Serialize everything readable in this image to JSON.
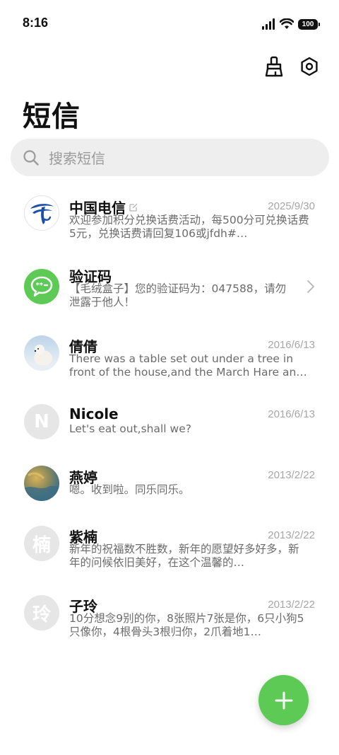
{
  "status_bar": {
    "time": "8:16",
    "battery": "100"
  },
  "toolbar": {
    "clean_icon": "broom-icon",
    "settings_icon": "settings-icon"
  },
  "page": {
    "title": "短信"
  },
  "search": {
    "placeholder": "搜索短信"
  },
  "conversations": [
    {
      "name": "中国电信",
      "date": "2025/9/30",
      "preview": "欢迎参加积分兑换话费活动，每500分可兑换话费5元，兑换话费请回复106或jfdh#…",
      "avatar": "china-telecom-logo",
      "has_edit_badge": true
    },
    {
      "name": "验证码",
      "date": "",
      "preview": "【毛绒盒子】您的验证码为：047588，请勿泄露于他人！",
      "avatar": "verification-code-icon",
      "has_chevron": true
    },
    {
      "name": "倩倩",
      "date": "2016/6/13",
      "preview": "There was a table set out under a tree in front of the house,and the March Hare an…",
      "avatar": "polar-bear-photo"
    },
    {
      "name": "Nicole",
      "date": "2016/6/13",
      "preview": "Let's eat out,shall we?",
      "avatar_letter": "N"
    },
    {
      "name": "燕婷",
      "date": "2013/2/22",
      "preview": "嗯。收到啦。同乐同乐。",
      "avatar": "landscape-photo"
    },
    {
      "name": "紫楠",
      "date": "2013/2/22",
      "preview": "新年的祝福数不胜数，新年的愿望好多好多，新年的问候依旧美好，在这个温馨的…",
      "avatar_letter": "楠"
    },
    {
      "name": "子玲",
      "date": "2013/2/22",
      "preview": "10分想念9别的你，8张照片7张是你，6只小狗5只像你，4根骨头3根归你，2爪着地1…",
      "avatar_letter": "玲"
    }
  ],
  "fab": {
    "icon": "plus-icon"
  },
  "colors": {
    "accent_green": "#5cca55",
    "telecom_blue": "#1b4fa8"
  }
}
